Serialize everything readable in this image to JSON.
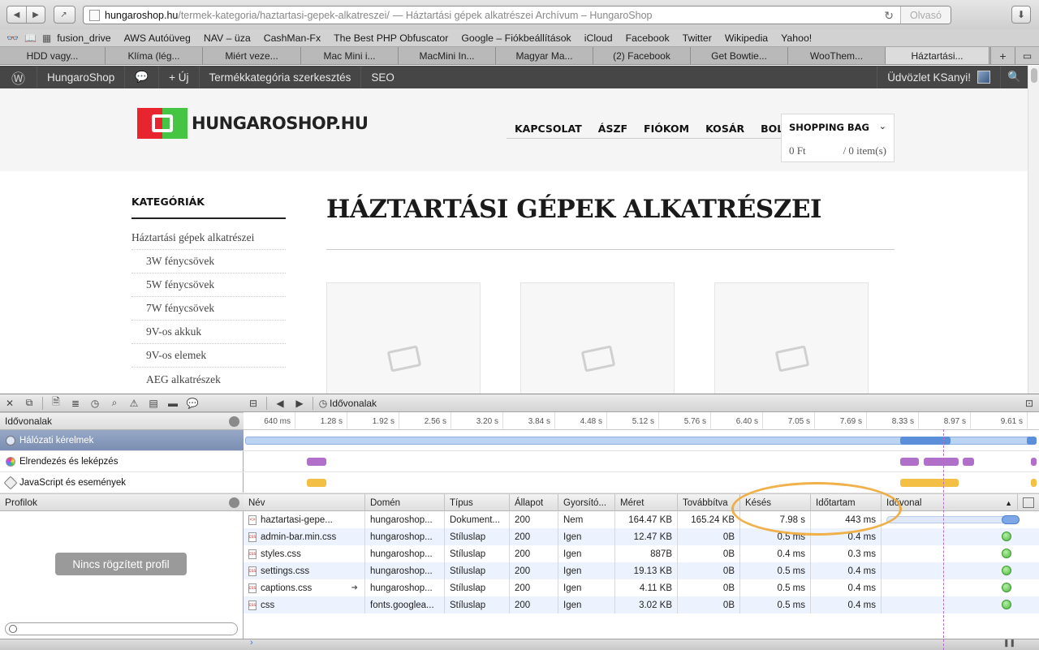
{
  "browser": {
    "url_host": "hungaroshop.hu",
    "url_path": "/termek-kategoria/haztartasi-gepek-alkatreszei/",
    "url_title": "— Háztartási gépek alkatrészei Archívum – HungaroShop",
    "reader_label": "Olvasó",
    "bookmarks": [
      "fusion_drive",
      "AWS Autóüveg",
      "NAV – üza",
      "CashMan-Fx",
      "The Best PHP Obfuscator",
      "Google – Fiókbeállítások",
      "iCloud",
      "Facebook",
      "Twitter",
      "Wikipedia",
      "Yahoo!"
    ],
    "tabs": [
      "HDD vagy...",
      "Klíma (lég...",
      "Miért veze...",
      "Mac Mini i...",
      "MacMini In...",
      "Magyar Ma...",
      "(2) Facebook",
      "Get Bowtie...",
      "WooThem...",
      "Háztartási..."
    ]
  },
  "adminbar": {
    "site": "HungaroShop",
    "new": "+ Új",
    "edit": "Termékkategória szerkesztés",
    "seo": "SEO",
    "greeting": "Üdvözlet KSanyi!"
  },
  "site": {
    "logo_text": "HUNGAROSHOP.HU",
    "nav": [
      "KAPCSOLAT",
      "ÁSZF",
      "FIÓKOM",
      "KOSÁR",
      "BOLT"
    ],
    "bag_title": "SHOPPING BAG",
    "bag_total": "0 Ft",
    "bag_items": "/ 0 item(s)",
    "categories_title": "KATEGÓRIÁK",
    "categories": [
      "Háztartási gépek alkatrészei",
      "3W fénycsövek",
      "5W fénycsövek",
      "7W fénycsövek",
      "9V-os akkuk",
      "9V-os elemek",
      "AEG alkatrészek"
    ],
    "page_title": "HÁZTARTÁSI GÉPEK ALKATRÉSZEI"
  },
  "inspector": {
    "timelines_label": "Idővonalak",
    "timeline_rows": [
      "Hálózati kérelmek",
      "Elrendezés és leképzés",
      "JavaScript és események"
    ],
    "profiles_label": "Profilok",
    "no_profile": "Nincs rögzített profil",
    "breadcrumb": "Idővonalak",
    "ticks": [
      "640 ms",
      "1.28 s",
      "1.92 s",
      "2.56 s",
      "3.20 s",
      "3.84 s",
      "4.48 s",
      "5.12 s",
      "5.76 s",
      "6.40 s",
      "7.05 s",
      "7.69 s",
      "8.33 s",
      "8.97 s",
      "9.61 s"
    ],
    "columns": [
      "Név",
      "Domén",
      "Típus",
      "Állapot",
      "Gyorsító...",
      "Méret",
      "Továbbítva",
      "Késés",
      "Időtartam",
      "Idővonal"
    ],
    "rows": [
      {
        "name": "haztartasi-gepe...",
        "domain": "hungaroshop...",
        "type": "Dokument...",
        "status": "200",
        "cached": "Nem",
        "size": "164.47 KB",
        "transferred": "165.24 KB",
        "latency": "7.98 s",
        "duration": "443 ms"
      },
      {
        "name": "admin-bar.min.css",
        "domain": "hungaroshop...",
        "type": "Stíluslap",
        "status": "200",
        "cached": "Igen",
        "size": "12.47 KB",
        "transferred": "0B",
        "latency": "0.5 ms",
        "duration": "0.4 ms"
      },
      {
        "name": "styles.css",
        "domain": "hungaroshop...",
        "type": "Stíluslap",
        "status": "200",
        "cached": "Igen",
        "size": "887B",
        "transferred": "0B",
        "latency": "0.4 ms",
        "duration": "0.3 ms"
      },
      {
        "name": "settings.css",
        "domain": "hungaroshop...",
        "type": "Stíluslap",
        "status": "200",
        "cached": "Igen",
        "size": "19.13 KB",
        "transferred": "0B",
        "latency": "0.5 ms",
        "duration": "0.4 ms"
      },
      {
        "name": "captions.css",
        "domain": "hungaroshop...",
        "type": "Stíluslap",
        "status": "200",
        "cached": "Igen",
        "size": "4.11 KB",
        "transferred": "0B",
        "latency": "0.5 ms",
        "duration": "0.4 ms"
      },
      {
        "name": "css",
        "domain": "fonts.googlea...",
        "type": "Stíluslap",
        "status": "200",
        "cached": "Igen",
        "size": "3.02 KB",
        "transferred": "0B",
        "latency": "0.5 ms",
        "duration": "0.4 ms"
      }
    ],
    "colors": {
      "network": "#5b8fd9",
      "layout": "#b06fc9",
      "script": "#f3bf45",
      "annotation": "#f0a936"
    }
  }
}
